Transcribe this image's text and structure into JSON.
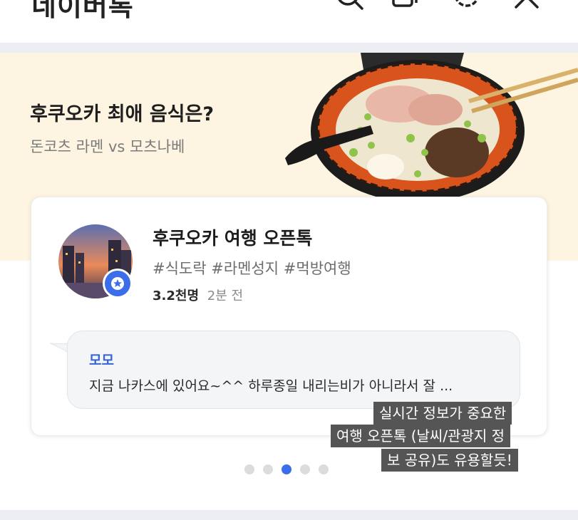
{
  "appbar": {
    "title": "네이버톡",
    "icons": [
      "search-icon",
      "chat-add-icon",
      "settings-icon",
      "close-icon"
    ]
  },
  "banner": {
    "headline": "후쿠오카 최애 음식은?",
    "subtitle": "돈코츠 라멘 vs 모츠나베",
    "background": "#fdf5e1"
  },
  "card": {
    "room_name": "후쿠오카 여행 오픈톡",
    "tags": "#식도락 #라멘성지 #먹방여행",
    "member_count": "3.2천명",
    "last_active": "2분 전",
    "last_message": {
      "sender": "모모",
      "text": "지금 나카스에 있어요~^^ 하루종일 내리는비가 아니라서 잘 ..."
    }
  },
  "caption": {
    "lines": [
      "실시간 정보가 중요한",
      "여행 오픈톡 (날씨/관광지 정",
      "보 공유)도 유용할듯!"
    ]
  },
  "pagination": {
    "total": 5,
    "active_index": 2
  },
  "colors": {
    "accent": "#3b6ee8",
    "separator": "#eceef3"
  }
}
